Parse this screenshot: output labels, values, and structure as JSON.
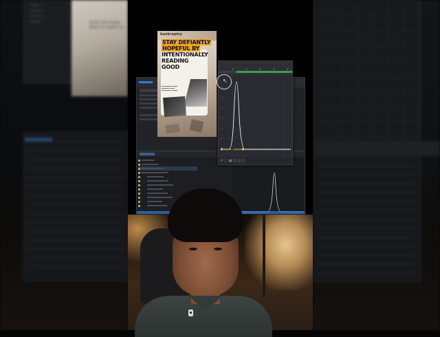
{
  "poster": {
    "top_strip_text": "bankruptcy",
    "headline_lines": [
      "STAY DEFIANTLY",
      "HOPEFUL BY",
      "INTENTIONALLY",
      "READING",
      "GOOD"
    ],
    "highlight_color": "#f0a51c"
  },
  "graph_editor": {
    "accent_green": "#3f9f4a",
    "curve_color": "#e8e8e8",
    "keyframe_color": "#e0c24a"
  },
  "after_effects": {
    "accent_blue": "#2f7fd8",
    "layer_count": 12
  },
  "background_blur_text": {
    "left_panel_items": [
      "Comp 1",
      "Layers",
      "Effects",
      "Graph"
    ],
    "left_photo_text": [
      "Good news happe",
      "Read this week's ne"
    ]
  },
  "icons": [
    "cursor-circle-icon",
    "microphone-icon"
  ]
}
